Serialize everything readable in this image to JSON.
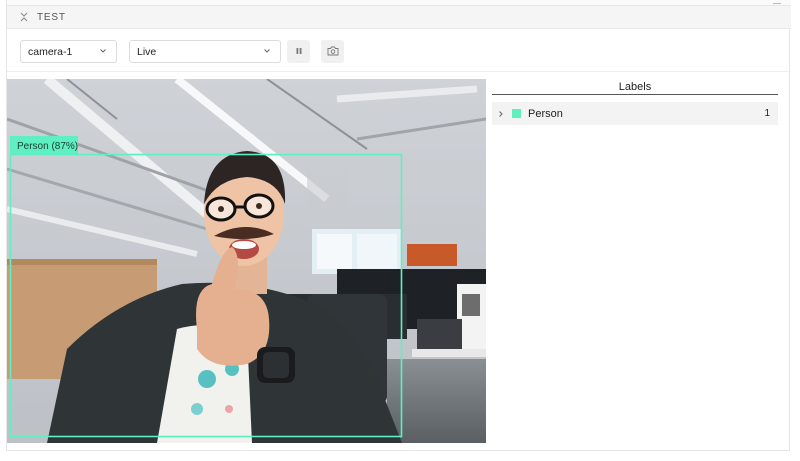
{
  "panel": {
    "title": "TEST"
  },
  "toolbar": {
    "camera": {
      "value": "camera-1"
    },
    "mode": {
      "value": "Live"
    }
  },
  "detection": {
    "label": "Person (87%)",
    "confidence_percent": 87,
    "color": "#5ef0c0"
  },
  "labels_panel": {
    "heading": "Labels",
    "items": [
      {
        "name": "Person",
        "count": "1",
        "color": "#5ef0c0"
      }
    ]
  },
  "colors": {
    "accent_box": "#5ef0c0",
    "header_bg": "#f5f5f5",
    "button_bg": "#f0f0f0"
  }
}
